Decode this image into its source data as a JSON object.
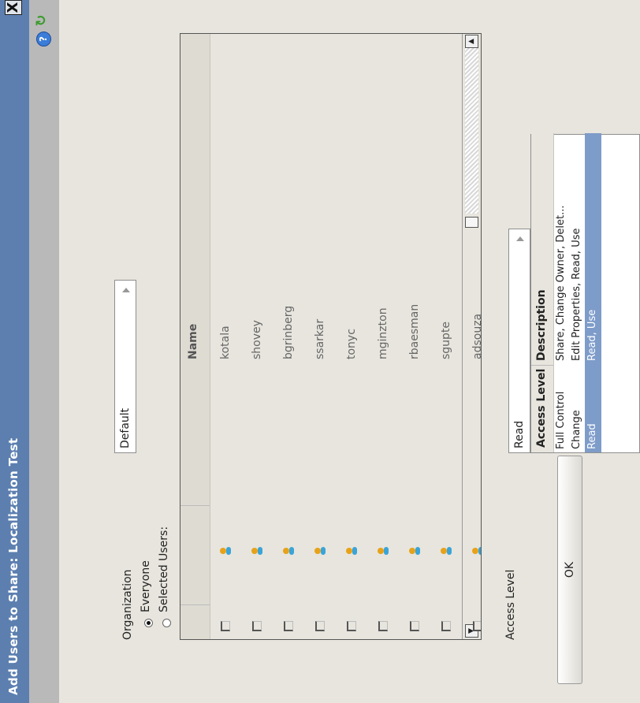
{
  "window": {
    "title": "Add Users to Share: Localization Test",
    "close_glyph": "X"
  },
  "organization": {
    "label": "Organization",
    "selected_value": "Default",
    "options": [
      {
        "label": "Everyone",
        "selected": true
      },
      {
        "label": "Selected Users:",
        "selected": false
      }
    ]
  },
  "users_table": {
    "columns": [
      "",
      "",
      "Name"
    ],
    "rows": [
      {
        "name": "kotala"
      },
      {
        "name": "shovey"
      },
      {
        "name": "bgrinberg"
      },
      {
        "name": "ssarkar"
      },
      {
        "name": "tonyc"
      },
      {
        "name": "mginzton"
      },
      {
        "name": "rbaesman"
      },
      {
        "name": "sgupte"
      },
      {
        "name": "adsouza"
      }
    ]
  },
  "access": {
    "label": "Access Level",
    "selected_value": "Read",
    "table_headers": [
      "Access Level",
      "Description"
    ],
    "levels": [
      {
        "level": "Full Control",
        "description": "Share, Change Owner, Delet...",
        "selected": false
      },
      {
        "level": "Change",
        "description": "Edit Properties, Read, Use",
        "selected": false
      },
      {
        "level": "Read",
        "description": "Read, Use",
        "selected": true
      }
    ]
  },
  "buttons": {
    "ok_label": "OK"
  },
  "icons": {
    "refresh": "refresh-icon",
    "help": "help-icon",
    "user": "user-icon"
  },
  "colors": {
    "title_bar": "#5c7fb0",
    "selection": "#7e9cc9",
    "background": "#e7e5dd"
  }
}
